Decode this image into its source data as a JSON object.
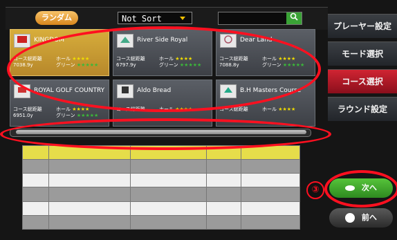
{
  "toolbar": {
    "random_label": "ランダム",
    "sort_value": "Not Sort",
    "search_placeholder": ""
  },
  "menu": {
    "player_settings": "プレーヤー設定",
    "mode_select": "モード選択",
    "course_select": "コース選択",
    "round_settings": "ラウンド設定"
  },
  "cards": [
    {
      "name": "KINGDOM",
      "dist_label": "コース総距離",
      "dist_value": "7038.9y",
      "hole_label": "ホール",
      "green_label": "グリーン"
    },
    {
      "name": "River Side Royal",
      "dist_label": "コース総距離",
      "dist_value": "6797.9y",
      "hole_label": "ホール",
      "green_label": "グリーン"
    },
    {
      "name": "Dear Land",
      "dist_label": "コース総距離",
      "dist_value": "7088.8y",
      "hole_label": "ホール",
      "green_label": "グリーン"
    },
    {
      "name": "ROYAL GOLF COUNTRY",
      "dist_label": "コース総距離",
      "dist_value": "6951.0y",
      "hole_label": "ホール",
      "green_label": "グリーン"
    },
    {
      "name": "Aldo Bread",
      "dist_label": "コース総距離",
      "dist_value": "",
      "hole_label": "ホール",
      "green_label": ""
    },
    {
      "name": "B.H Masters Course",
      "dist_label": "コース総距離",
      "dist_value": "",
      "hole_label": "ホール",
      "green_label": ""
    }
  ],
  "stars": {
    "hole": "★★★★",
    "green": "★★★★★"
  },
  "buttons": {
    "next": "次へ",
    "prev": "前へ"
  },
  "annotation": {
    "step": "③"
  },
  "colors": {
    "accent_red": "#ff1020",
    "active_menu": "#c01c2c",
    "selected_card": "#c9a03a",
    "next_green": "#3fa52e"
  }
}
